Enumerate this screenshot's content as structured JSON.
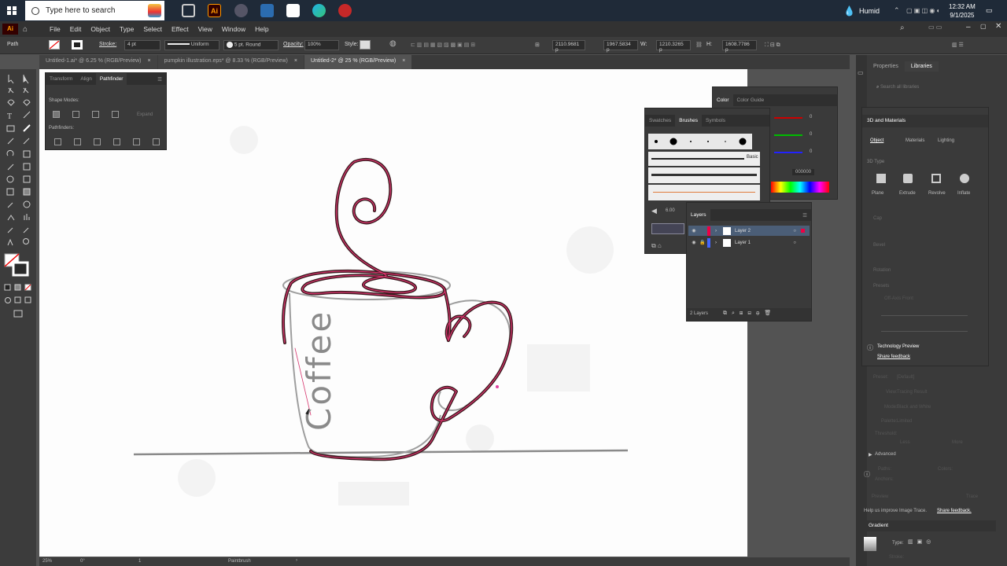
{
  "taskbar": {
    "search_placeholder": "Type here to search",
    "weather": "Humid",
    "time": "12:32 AM",
    "date": "9/1/2025"
  },
  "app": {
    "logo": "Ai",
    "menu": [
      "File",
      "Edit",
      "Object",
      "Type",
      "Select",
      "Effect",
      "View",
      "Window",
      "Help"
    ]
  },
  "control": {
    "selection": "Path",
    "stroke_label": "Stroke:",
    "stroke_weight": "4 pt",
    "profile": "Uniform",
    "brush": "5 pt. Round",
    "opacity_label": "Opacity:",
    "opacity": "100%",
    "style_label": "Style:",
    "x": "2110.9681 p",
    "y": "1967.5834 p",
    "w_label": "W:",
    "w": "1210.3265 p",
    "h_label": "H:",
    "h": "1608.7786 p"
  },
  "tabs": [
    {
      "label": "Untitled-1.ai* @ 6.25 % (RGB/Preview)"
    },
    {
      "label": "pumpkin illustration.eps* @ 8.33 % (RGB/Preview)"
    },
    {
      "label": "Untitled-2* @ 25 % (RGB/Preview)"
    }
  ],
  "pathfinder_panel": {
    "tabs": [
      "Transform",
      "Align",
      "Pathfinder"
    ],
    "shape_modes": "Shape Modes:",
    "expand": "Expand",
    "pathfinders": "Pathfinders:"
  },
  "brushes_panel": {
    "tabs": [
      "Swatches",
      "Brushes",
      "Symbols"
    ],
    "basic": "Basic",
    "size": "6.00"
  },
  "color_panel": {
    "tabs": [
      "Color",
      "Color Guide"
    ],
    "r": "0",
    "g": "0",
    "b": "0",
    "hex": "000000"
  },
  "layers_panel": {
    "title": "Layers",
    "layers": [
      "Layer 2",
      "Layer 1"
    ],
    "footer": "2 Layers"
  },
  "right_dock": {
    "tabs": [
      "Properties",
      "Libraries"
    ],
    "search_placeholder": "Search all libraries",
    "materials_panel": {
      "title": "3D and Materials",
      "tabs": [
        "Object",
        "Materials",
        "Lighting"
      ],
      "type_label": "3D Type",
      "types": [
        "Plane",
        "Extrude",
        "Revolve",
        "Inflate"
      ],
      "cap": "Cap",
      "bevel": "Bevel",
      "rotation": "Rotation",
      "presets": "Presets",
      "preset_value": "Off-Axis Front",
      "tech_preview": "Technology Preview",
      "share_feedback": "Share feedback"
    },
    "image_trace": {
      "preset_label": "Preset:",
      "preset": "[Default]",
      "view_label": "View:",
      "view": "Tracing Result",
      "mode_label": "Mode:",
      "mode": "Black and White",
      "palette_label": "Palette:",
      "palette": "Limited",
      "threshold": "Threshold:",
      "less": "Less",
      "more": "More",
      "advanced": "Advanced",
      "paths": "Paths:",
      "colors": "Colors:",
      "anchors": "Anchors:",
      "preview": "Preview",
      "trace": "Trace",
      "help": "Help us improve Image Trace.",
      "share": "Share feedback."
    },
    "gradient": {
      "title": "Gradient",
      "type_label": "Type:",
      "stroke_label": "Stroke:"
    }
  },
  "artwork": {
    "text": "Coffee"
  },
  "status": {
    "zoom": "25%",
    "rotate": "0°",
    "artboard": "1",
    "tool": "Paintbrush"
  },
  "colors": {
    "path_highlight": "#d6336c",
    "stroke": "#3a1a1e",
    "selection_box": "#9e9e9e"
  }
}
